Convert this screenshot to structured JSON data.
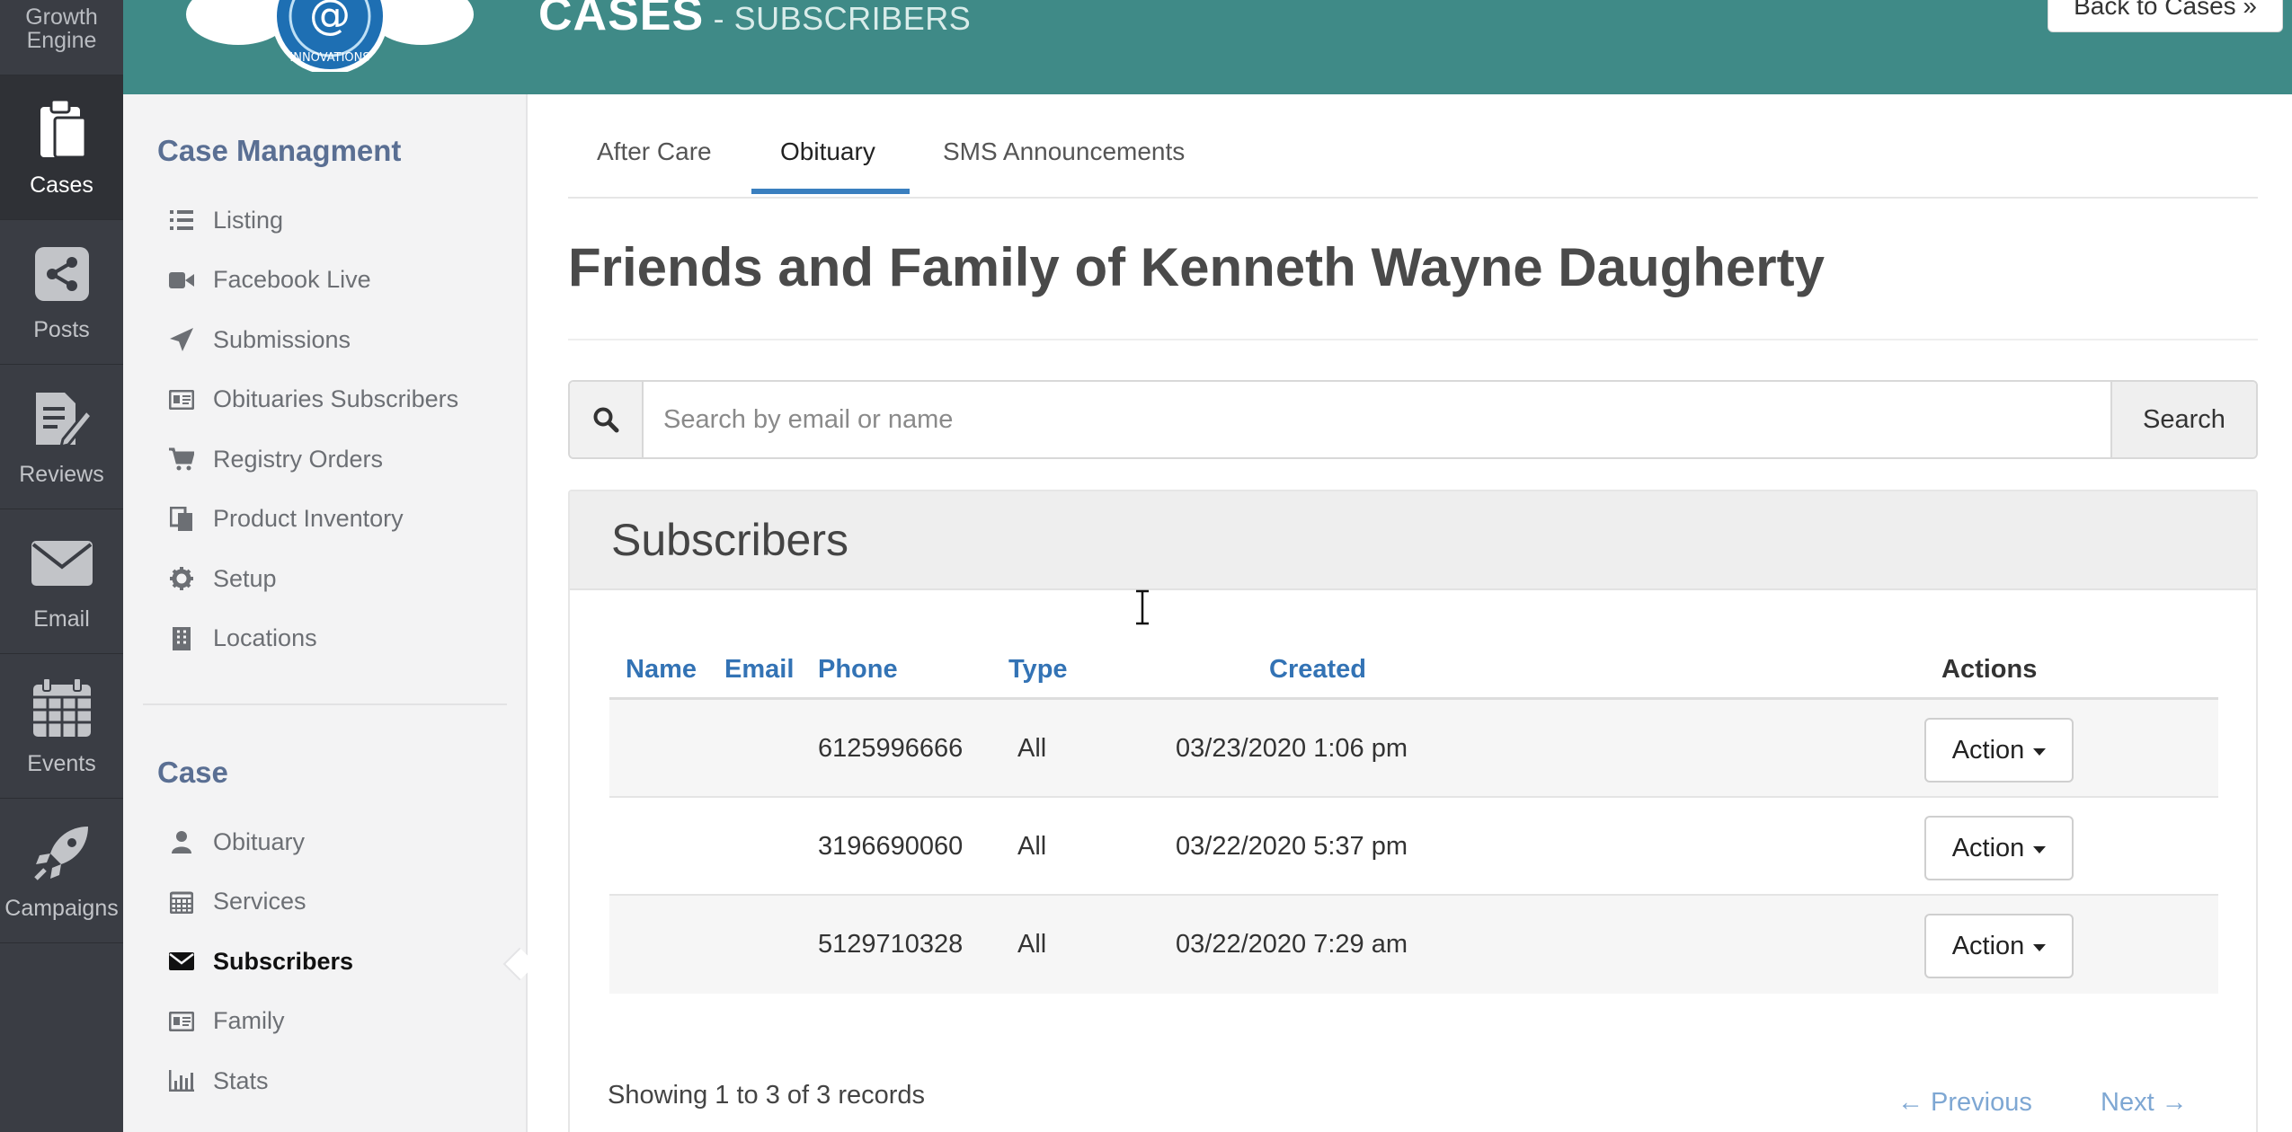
{
  "rail": {
    "brand": [
      "Growth",
      "Engine"
    ],
    "items": [
      {
        "label": "Cases",
        "icon": "clipboard-icon",
        "active": true
      },
      {
        "label": "Posts",
        "icon": "share-icon"
      },
      {
        "label": "Reviews",
        "icon": "document-edit-icon"
      },
      {
        "label": "Email",
        "icon": "envelope-icon"
      },
      {
        "label": "Events",
        "icon": "calendar-icon"
      },
      {
        "label": "Campaigns",
        "icon": "rocket-icon"
      }
    ]
  },
  "header": {
    "logo_text": "INNOVATIONS",
    "title": "CASES",
    "subtitle": " - SUBSCRIBERS",
    "back_button": "Back to Cases »",
    "color": "#3f8a87"
  },
  "sidebar": {
    "section1_title": "Case Managment",
    "section1_items": [
      {
        "label": "Listing",
        "icon": "list-icon"
      },
      {
        "label": "Facebook Live",
        "icon": "video-camera-icon"
      },
      {
        "label": "Submissions",
        "icon": "paper-plane-icon"
      },
      {
        "label": "Obituaries Subscribers",
        "icon": "id-card-icon"
      },
      {
        "label": "Registry Orders",
        "icon": "shopping-cart-icon"
      },
      {
        "label": "Product Inventory",
        "icon": "copy-icon"
      },
      {
        "label": "Setup",
        "icon": "gear-icon"
      },
      {
        "label": "Locations",
        "icon": "building-icon"
      }
    ],
    "section2_title": "Case",
    "section2_items": [
      {
        "label": "Obituary",
        "icon": "user-icon"
      },
      {
        "label": "Services",
        "icon": "calendar-icon"
      },
      {
        "label": "Subscribers",
        "icon": "envelope-icon",
        "active": true
      },
      {
        "label": "Family",
        "icon": "id-card-icon"
      },
      {
        "label": "Stats",
        "icon": "bar-chart-icon"
      }
    ]
  },
  "tabs": [
    {
      "label": "After Care"
    },
    {
      "label": "Obituary",
      "active": true
    },
    {
      "label": "SMS Announcements"
    }
  ],
  "page_title": "Friends and Family of Kenneth Wayne Daugherty",
  "search": {
    "placeholder": "Search by email or name",
    "value": "",
    "button": "Search"
  },
  "panel": {
    "title": "Subscribers",
    "columns": {
      "name": "Name",
      "email": "Email",
      "phone": "Phone",
      "type": "Type",
      "created": "Created",
      "actions": "Actions"
    },
    "rows": [
      {
        "name": "",
        "email": "",
        "phone": "6125996666",
        "type": "All",
        "created": "03/23/2020 1:06 pm",
        "action": "Action"
      },
      {
        "name": "",
        "email": "",
        "phone": "3196690060",
        "type": "All",
        "created": "03/22/2020 5:37 pm",
        "action": "Action"
      },
      {
        "name": "",
        "email": "",
        "phone": "5129710328",
        "type": "All",
        "created": "03/22/2020 7:29 am",
        "action": "Action"
      }
    ],
    "footer_info": "Showing 1 to 3 of 3 records",
    "prev": "← Previous",
    "next": "Next →"
  },
  "colors": {
    "link": "#3373b5",
    "tab_active": "#3a7fbf",
    "rail_bg": "#3a3d44"
  }
}
